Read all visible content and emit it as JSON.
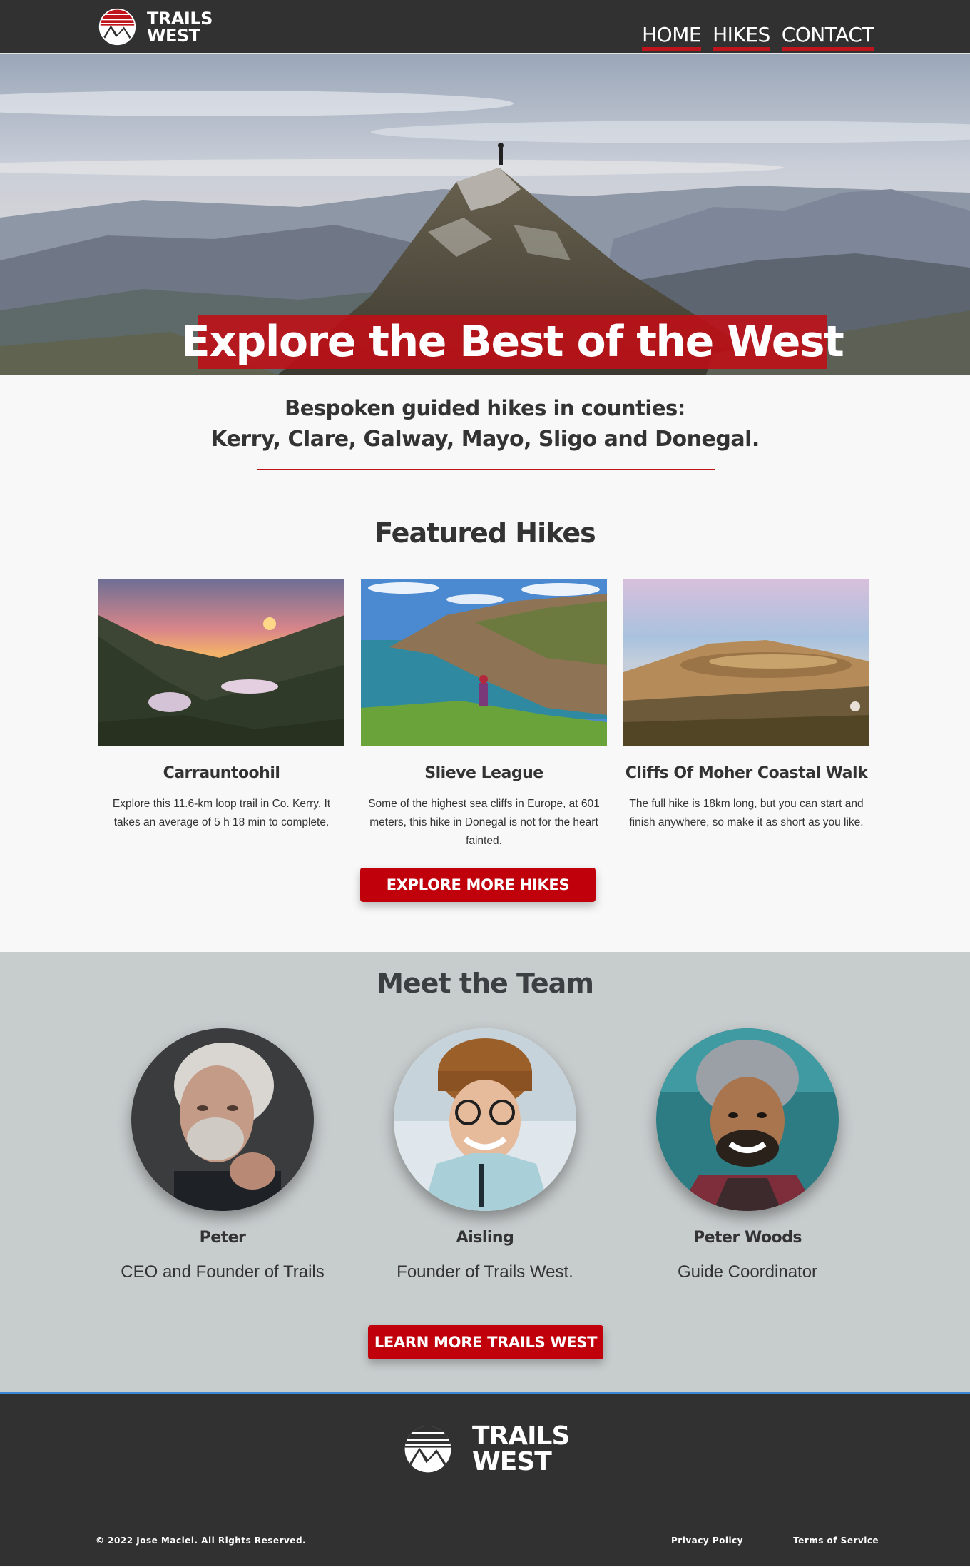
{
  "header": {
    "logo_line1": "TRAILS",
    "logo_line2": "WEST",
    "nav": [
      {
        "label": "HOME"
      },
      {
        "label": "HIKES"
      },
      {
        "label": "CONTACT"
      }
    ]
  },
  "hero": {
    "title": "Explore the Best of the West"
  },
  "intro": {
    "line1": "Bespoken guided hikes in counties:",
    "line2": "Kerry, Clare, Galway, Mayo, Sligo and Donegal."
  },
  "featured": {
    "title": "Featured Hikes",
    "cards": [
      {
        "title": "Carrauntoohil",
        "text": "Explore this 11.6-km loop trail in Co. Kerry. It takes an average of 5 h 18 min to complete.",
        "image": "mountain-sunset-lakes"
      },
      {
        "title": "Slieve League",
        "text": "Some of the highest sea cliffs in Europe, at 601 meters, this hike in Donegal is not for the heart fainted.",
        "image": "sea-cliffs-hiker"
      },
      {
        "title": "Cliffs Of Moher Coastal Walk",
        "text": "The full hike is 18km long, but you can start and finish anywhere, so make it as short as you like.",
        "image": "limestone-pavement"
      }
    ],
    "button_label": "EXPLORE MORE HIKES"
  },
  "team": {
    "title": "Meet the Team",
    "members": [
      {
        "name": "Peter",
        "role": "CEO and Founder of Trails",
        "image": "elderly-man-portrait"
      },
      {
        "name": "Aisling",
        "role": "Founder of Trails West.",
        "image": "woman-beanie-portrait"
      },
      {
        "name": "Peter Woods",
        "role": "Guide Coordinator",
        "image": "man-beanie-portrait"
      }
    ],
    "button_label": "LEARN MORE TRAILS WEST"
  },
  "footer": {
    "logo_line1": "TRAILS",
    "logo_line2": "WEST",
    "copyright": "© 2022 Jose Maciel.  All Rights Reserved.",
    "links": [
      {
        "label": "Privacy Policy"
      },
      {
        "label": "Terms of Service"
      }
    ]
  },
  "colors": {
    "accent": "#c0141c",
    "header_bg": "#313131",
    "team_bg": "#c7cccd",
    "footer_border": "#3b86d6"
  }
}
